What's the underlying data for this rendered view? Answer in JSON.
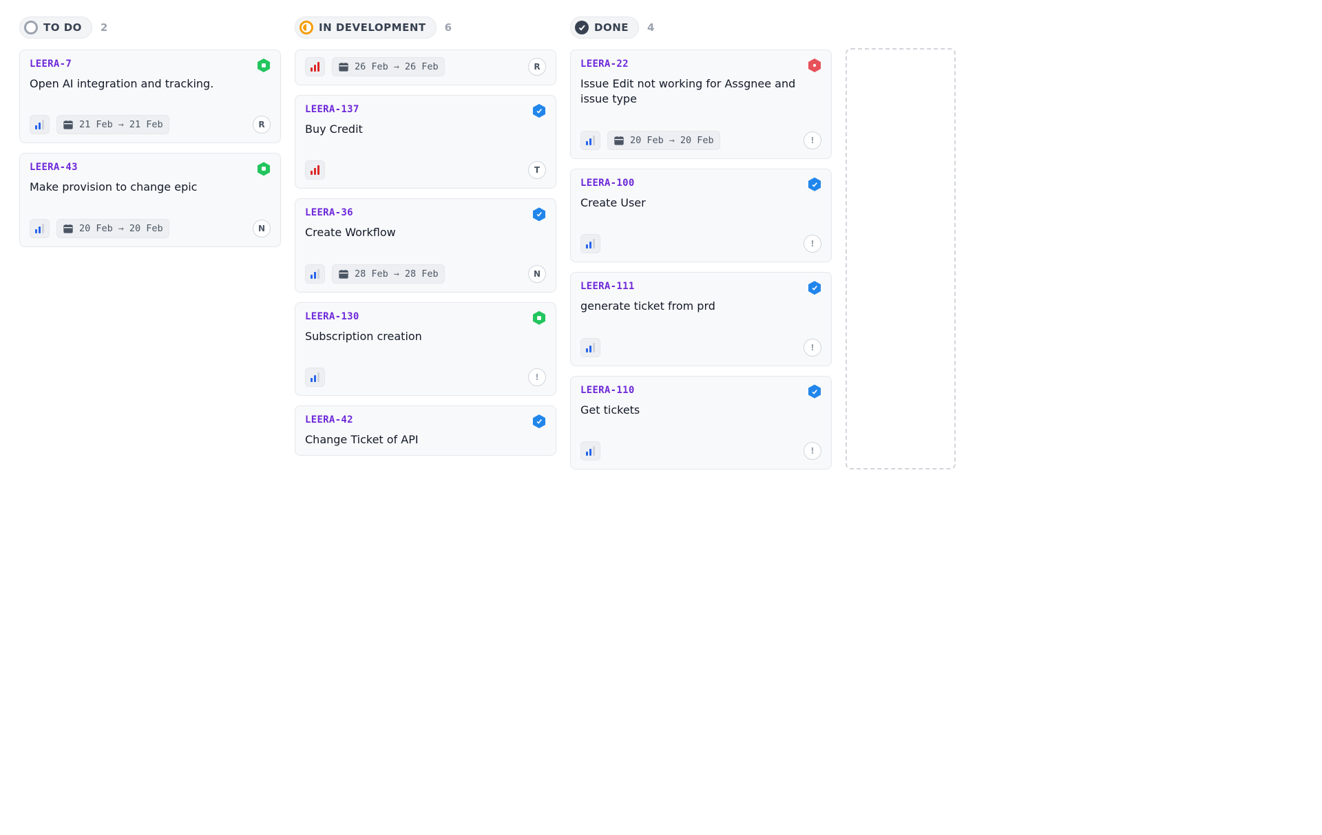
{
  "columns": [
    {
      "id": "todo",
      "title": "TO DO",
      "count": 2,
      "status": "todo"
    },
    {
      "id": "dev",
      "title": "IN DEVELOPMENT",
      "count": 6,
      "status": "dev"
    },
    {
      "id": "done",
      "title": "DONE",
      "count": 4,
      "status": "done"
    }
  ],
  "cards": {
    "todo": [
      {
        "key": "LEERA-7",
        "title": "Open AI integration and tracking.",
        "type": "story",
        "priority": "medium",
        "date_from": "21 Feb",
        "date_to": "21 Feb",
        "assignee": "R"
      },
      {
        "key": "LEERA-43",
        "title": "Make provision to change epic",
        "type": "story",
        "priority": "medium",
        "date_from": "20 Feb",
        "date_to": "20 Feb",
        "assignee": "N"
      }
    ],
    "dev": [
      {
        "key": "",
        "title": "",
        "type": "",
        "priority": "highest",
        "date_from": "26 Feb",
        "date_to": "26 Feb",
        "assignee": "R",
        "partial_top": true
      },
      {
        "key": "LEERA-137",
        "title": "Buy Credit",
        "type": "task",
        "priority": "highest",
        "assignee": "T"
      },
      {
        "key": "LEERA-36",
        "title": "Create Workflow",
        "type": "task",
        "priority": "medium",
        "date_from": "28 Feb",
        "date_to": "28 Feb",
        "assignee": "N"
      },
      {
        "key": "LEERA-130",
        "title": "Subscription creation",
        "type": "story",
        "priority": "medium",
        "assignee": "!"
      },
      {
        "key": "LEERA-42",
        "title": "Change Ticket of API",
        "type": "task",
        "priority": "medium",
        "assignee": "",
        "cut_bottom": true
      }
    ],
    "done": [
      {
        "key": "LEERA-22",
        "title": "Issue Edit not working for Assgnee and issue type",
        "type": "bug",
        "priority": "medium",
        "date_from": "20 Feb",
        "date_to": "20 Feb",
        "assignee": "!"
      },
      {
        "key": "LEERA-100",
        "title": "Create User",
        "type": "task",
        "priority": "medium",
        "assignee": "!"
      },
      {
        "key": "LEERA-111",
        "title": "generate ticket from prd",
        "type": "task",
        "priority": "medium",
        "assignee": "!"
      },
      {
        "key": "LEERA-110",
        "title": "Get tickets",
        "type": "task",
        "priority": "medium",
        "assignee": "!"
      }
    ]
  }
}
